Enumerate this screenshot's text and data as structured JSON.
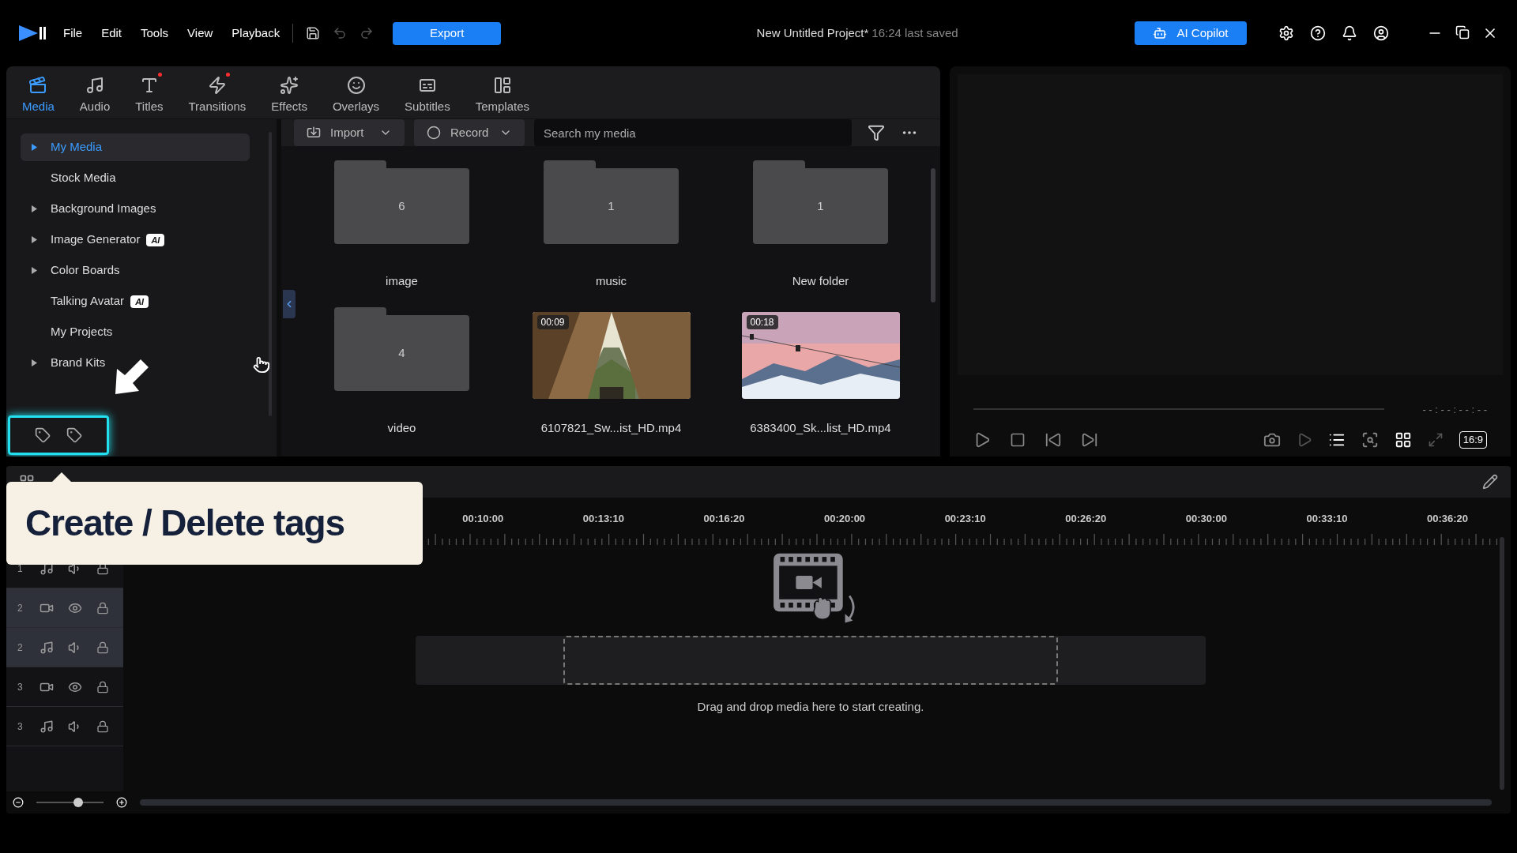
{
  "menu": [
    "File",
    "Edit",
    "Tools",
    "View",
    "Playback"
  ],
  "export_button": "Export",
  "project": {
    "title": "New Untitled Project*",
    "saved": "16:24 last saved"
  },
  "copilot_button": "AI Copilot",
  "tabs": [
    {
      "label": "Media",
      "kind": "media",
      "selected": true,
      "badge": false
    },
    {
      "label": "Audio",
      "kind": "audio",
      "selected": false,
      "badge": false
    },
    {
      "label": "Titles",
      "kind": "titles",
      "selected": false,
      "badge": true
    },
    {
      "label": "Transitions",
      "kind": "transitions",
      "selected": false,
      "badge": true
    },
    {
      "label": "Effects",
      "kind": "effects",
      "selected": false,
      "badge": false
    },
    {
      "label": "Overlays",
      "kind": "overlays",
      "selected": false,
      "badge": false
    },
    {
      "label": "Subtitles",
      "kind": "subtitles",
      "selected": false,
      "badge": false
    },
    {
      "label": "Templates",
      "kind": "templates",
      "selected": false,
      "badge": false
    }
  ],
  "sidebar": {
    "items": [
      {
        "label": "My Media",
        "expandable": true,
        "selected": true
      },
      {
        "label": "Stock Media",
        "expandable": false,
        "selected": false
      },
      {
        "label": "Background Images",
        "expandable": true,
        "selected": false
      },
      {
        "label": "Image Generator",
        "expandable": true,
        "selected": false,
        "badge": "AI"
      },
      {
        "label": "Color Boards",
        "expandable": true,
        "selected": false
      },
      {
        "label": "Talking Avatar",
        "expandable": false,
        "selected": false,
        "badge": "AI"
      },
      {
        "label": "My Projects",
        "expandable": false,
        "selected": false
      },
      {
        "label": "Brand Kits",
        "expandable": true,
        "selected": false
      }
    ]
  },
  "toolbar": {
    "import": "Import",
    "record": "Record",
    "search_placeholder": "Search my media"
  },
  "media": [
    {
      "kind": "folder",
      "count": "6",
      "name": "image"
    },
    {
      "kind": "folder",
      "count": "1",
      "name": "music"
    },
    {
      "kind": "folder",
      "count": "1",
      "name": "New folder"
    },
    {
      "kind": "folder",
      "count": "4",
      "name": "video"
    },
    {
      "kind": "video",
      "duration": "00:09",
      "name": "6107821_Sw...ist_HD.mp4"
    },
    {
      "kind": "video",
      "duration": "00:18",
      "name": "6383400_Sk...list_HD.mp4"
    }
  ],
  "preview": {
    "timecode": "- - : - - : - - : - -",
    "aspect": "16:9"
  },
  "tooltip": "Create / Delete tags",
  "ruler": [
    "00:10:00",
    "00:13:10",
    "00:16:20",
    "00:20:00",
    "00:23:10",
    "00:26:20",
    "00:30:00",
    "00:33:10",
    "00:36:20"
  ],
  "tracks": [
    {
      "number": "1",
      "kind": "audio",
      "selected": false
    },
    {
      "number": "2",
      "kind": "video",
      "selected": true
    },
    {
      "number": "2",
      "kind": "audio",
      "selected": true
    },
    {
      "number": "3",
      "kind": "video",
      "selected": false
    },
    {
      "number": "3",
      "kind": "audio",
      "selected": false
    }
  ],
  "drop_hint": "Drag and drop media here to start creating.",
  "zoom": {
    "level": 0.65
  }
}
